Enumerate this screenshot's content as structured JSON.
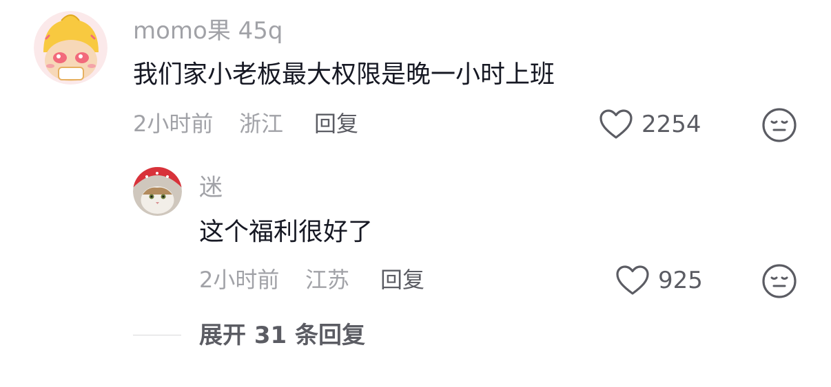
{
  "comments": [
    {
      "username": "momo果 45q",
      "text": "我们家小老板最大权限是晚一小时上班",
      "time": "2小时前",
      "location": "浙江",
      "reply_label": "回复",
      "likes": "2254",
      "avatar_icon": "cartoon-duck-avatar-icon"
    }
  ],
  "replies": [
    {
      "username": "迷",
      "text": "这个福利很好了",
      "time": "2小时前",
      "location": "江苏",
      "reply_label": "回复",
      "likes": "925",
      "avatar_icon": "cat-with-red-bandana-avatar-icon"
    }
  ],
  "expand_label": "展开 31 条回复",
  "colors": {
    "text_primary": "#161823",
    "text_secondary": "#a1a2a7",
    "text_action": "#5b5c63"
  }
}
